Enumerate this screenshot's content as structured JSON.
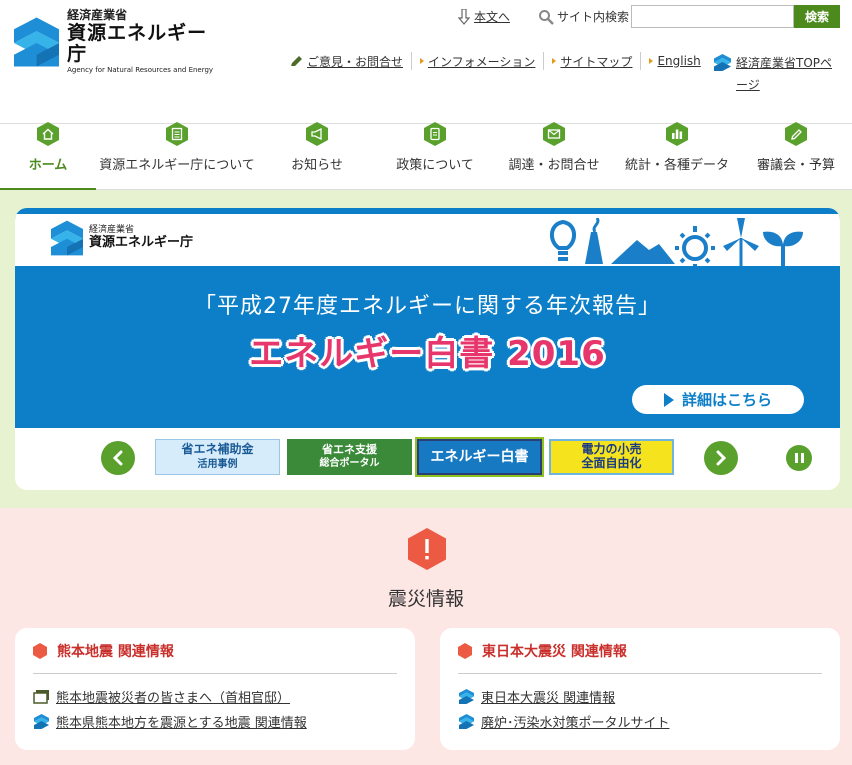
{
  "header": {
    "logo": {
      "ministry": "経済産業省",
      "agency": "資源エネルギー庁",
      "agency_en": "Agency for Natural Resources and Energy"
    },
    "skip_link": "本文へ",
    "search": {
      "label": "サイト内検索",
      "value": "",
      "placeholder": "",
      "button": "検索"
    },
    "subnav": [
      {
        "label": "ご意見・お問合せ",
        "icon": "pencil-icon"
      },
      {
        "label": "インフォメーション",
        "icon": "triangle-bullet-icon"
      },
      {
        "label": "サイトマップ",
        "icon": "triangle-bullet-icon"
      },
      {
        "label": "English",
        "icon": "triangle-bullet-icon"
      }
    ],
    "meti_top": "経済産業省TOPページ"
  },
  "global_nav": [
    {
      "label": "ホーム",
      "icon": "home-icon",
      "active": true
    },
    {
      "label": "資源エネルギー庁について",
      "icon": "document-icon",
      "active": false
    },
    {
      "label": "お知らせ",
      "icon": "megaphone-icon",
      "active": false
    },
    {
      "label": "政策について",
      "icon": "notepad-icon",
      "active": false
    },
    {
      "label": "調達・お問合せ",
      "icon": "mail-icon",
      "active": false
    },
    {
      "label": "統計・各種データ",
      "icon": "bar-chart-icon",
      "active": false
    },
    {
      "label": "審議会・予算",
      "icon": "pen-icon",
      "active": false
    }
  ],
  "carousel": {
    "banner": {
      "logo_ministry": "経済産業省",
      "logo_agency": "資源エネルギー庁",
      "subtitle": "「平成27年度エネルギーに関する年次報告」",
      "title": "エネルギー白書 2016",
      "detail_button": "詳細はこちら"
    },
    "thumbnails": [
      {
        "line1": "省エネ補助金",
        "line2": "活用事例"
      },
      {
        "line1": "省エネ支援",
        "line2": "総合ポータル"
      },
      {
        "line1": "エネルギー白書",
        "line2": ""
      },
      {
        "line1": "電力の小売",
        "line2": "全面自由化"
      }
    ]
  },
  "disaster": {
    "title": "震災情報",
    "panels": [
      {
        "heading": "熊本地震 関連情報",
        "links": [
          {
            "label": "熊本地震被災者の皆さまへ（首相官邸）",
            "icon": "window-icon"
          },
          {
            "label": "熊本県熊本地方を震源とする地震 関連情報",
            "icon": "meti-logo-icon"
          }
        ]
      },
      {
        "heading": "東日本大震災 関連情報",
        "links": [
          {
            "label": "東日本大震災 関連情報",
            "icon": "meti-logo-icon"
          },
          {
            "label": "廃炉･汚染水対策ポータルサイト",
            "icon": "meti-logo-icon"
          }
        ]
      }
    ]
  },
  "colors": {
    "brand_green": "#4d8a1e",
    "banner_blue": "#0d7fc9",
    "accent_red": "#c9302c",
    "carousel_bg": "#e7f3d0",
    "disaster_bg": "#fde7e5"
  }
}
